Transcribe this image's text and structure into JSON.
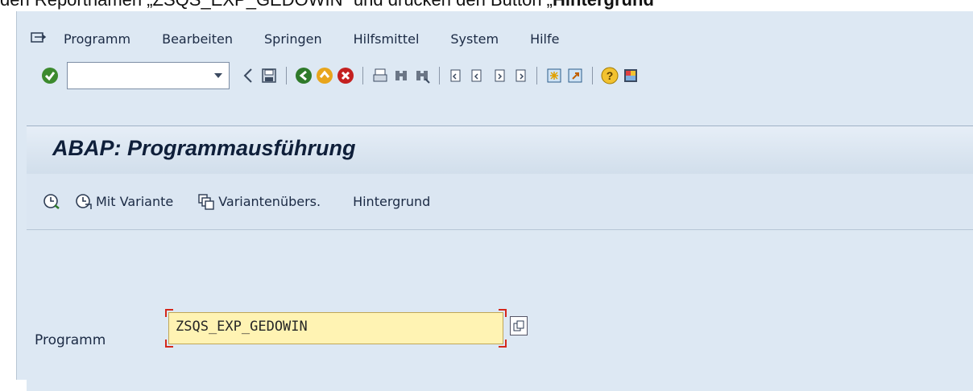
{
  "caption": {
    "prefix": "den Reportnamen „ZSQS_EXP_GEDOWIN“ und drücken den Button „",
    "bold": "Hintergrund"
  },
  "menubar": {
    "items": [
      "Programm",
      "Bearbeiten",
      "Springen",
      "Hilfsmittel",
      "System",
      "Hilfe"
    ]
  },
  "toolbar": {
    "command_value": "",
    "buttons": [
      "enter-check-icon",
      "back-arrow-icon",
      "save-icon",
      "back-icon",
      "exit-icon",
      "cancel-icon",
      "print-icon",
      "find-icon",
      "find-next-icon",
      "first-page-icon",
      "previous-page-icon",
      "next-page-icon",
      "last-page-icon",
      "new-session-icon",
      "shortcut-icon",
      "help-icon",
      "customize-icon"
    ]
  },
  "screen": {
    "title": "ABAP: Programmausführung",
    "app_buttons": {
      "execute": "",
      "with_variant": "Mit Variante",
      "variant_overview": "Variantenübers.",
      "background": "Hintergrund"
    }
  },
  "form": {
    "program_label": "Programm",
    "program_value": "ZSQS_EXP_GEDOWIN"
  },
  "colors": {
    "window_bg": "#dde8f3",
    "field_bg": "#fff3b3",
    "bracket": "#d4281c"
  }
}
